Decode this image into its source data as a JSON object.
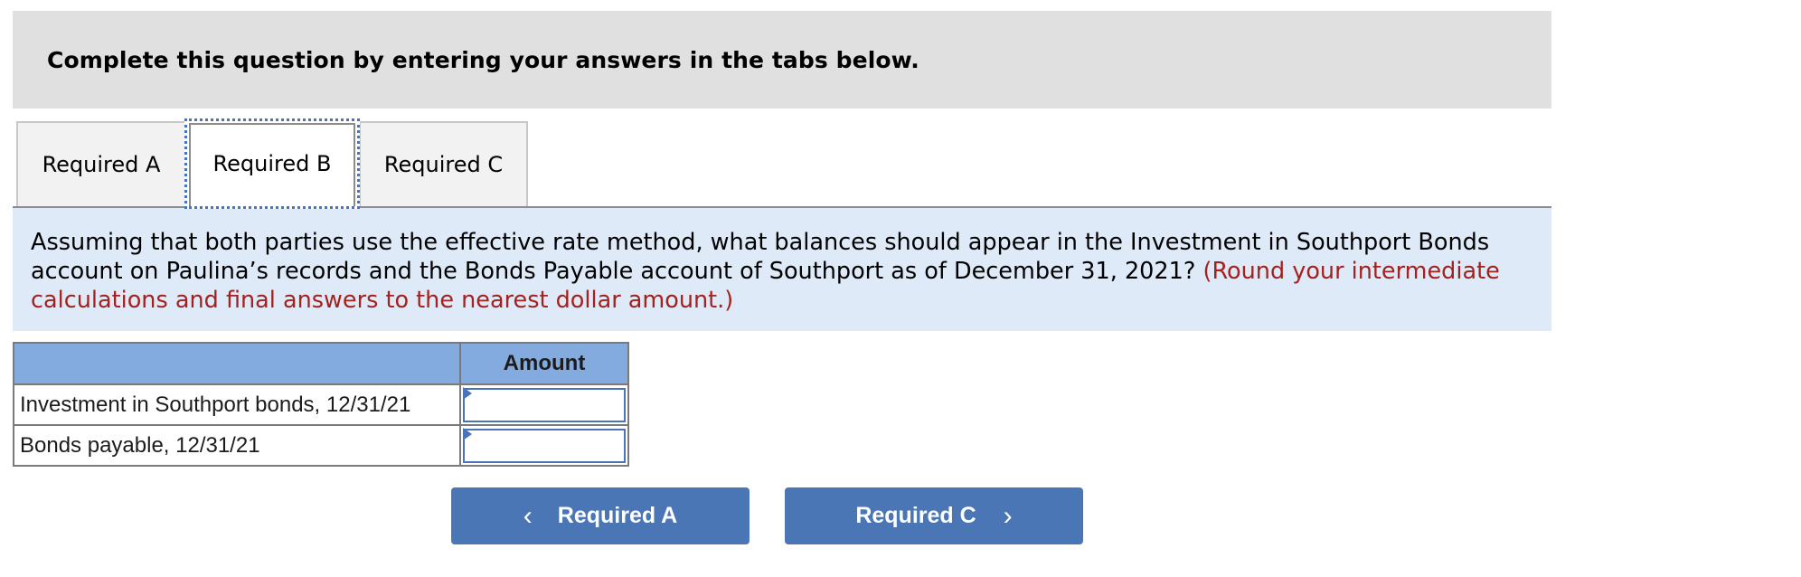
{
  "instruction": {
    "text": "Complete this question by entering your answers in the tabs below."
  },
  "tabs": [
    {
      "label": "Required A",
      "active": false
    },
    {
      "label": "Required B",
      "active": true
    },
    {
      "label": "Required C",
      "active": false
    }
  ],
  "question": {
    "text": "Assuming that both parties use the effective rate method, what balances should appear in the Investment in Southport Bonds account on Paulina’s records and the Bonds Payable account of Southport as of December 31, 2021?",
    "note": "(Round your intermediate calculations and final answers to the nearest dollar amount.)"
  },
  "table": {
    "headers": [
      "",
      "Amount"
    ],
    "rows": [
      {
        "label": "Investment in Southport bonds, 12/31/21",
        "value": "",
        "placeholder": ""
      },
      {
        "label": "Bonds payable, 12/31/21",
        "value": "",
        "placeholder": ""
      }
    ]
  },
  "navigation": {
    "prev_label": "Required A",
    "prev_icon": "chevron-left-icon",
    "next_label": "Required C",
    "next_icon": "chevron-right-icon"
  },
  "colors": {
    "header_bg": "#e0e0e0",
    "question_bg": "#deeaf7",
    "note_text": "#a3221f",
    "table_header_bg": "#84abdf",
    "button_bg": "#4a76b5",
    "focus_outline": "#4a73b8"
  }
}
